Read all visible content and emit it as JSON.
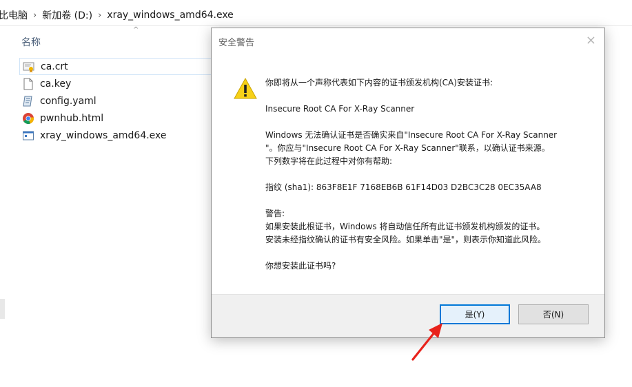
{
  "breadcrumb": {
    "items": [
      "比电脑",
      "新加卷 (D:)",
      "xray_windows_amd64.exe"
    ]
  },
  "column_header": {
    "name": "名称"
  },
  "files": [
    {
      "name": "ca.crt",
      "icon": "certificate-icon"
    },
    {
      "name": "ca.key",
      "icon": "blank-file-icon"
    },
    {
      "name": "config.yaml",
      "icon": "yaml-file-icon"
    },
    {
      "name": "pwnhub.html",
      "icon": "chrome-html-icon"
    },
    {
      "name": "xray_windows_amd64.exe",
      "icon": "exe-icon"
    }
  ],
  "dialog": {
    "title": "安全警告",
    "close": "×",
    "line1": "你即将从一个声称代表如下内容的证书颁发机构(CA)安装证书:",
    "ca_name": "Insecure Root CA For X-Ray Scanner",
    "confirm1": "Windows 无法确认证书是否确实来自\"Insecure Root CA For X-Ray Scanner",
    "confirm2": "\"。你应与\"Insecure Root CA For X-Ray Scanner\"联系，以确认证书来源。",
    "confirm3": "下列数字将在此过程中对你有帮助:",
    "thumbprint": "指纹 (sha1): 863F8E1F 7168EB6B 61F14D03 D2BC3C28 0EC35AA8",
    "warning_label": "警告:",
    "warning1": "如果安装此根证书，Windows 将自动信任所有此证书颁发机构颁发的证书。",
    "warning2": "安装未经指纹确认的证书有安全风险。如果单击\"是\"，则表示你知道此风险。",
    "question": "你想安装此证书吗?",
    "yes_label": "是(Y)",
    "no_label": "否(N)"
  },
  "colors": {
    "accent": "#0078d7",
    "annotation_arrow": "#e8221b",
    "warning": "#f7d118"
  }
}
